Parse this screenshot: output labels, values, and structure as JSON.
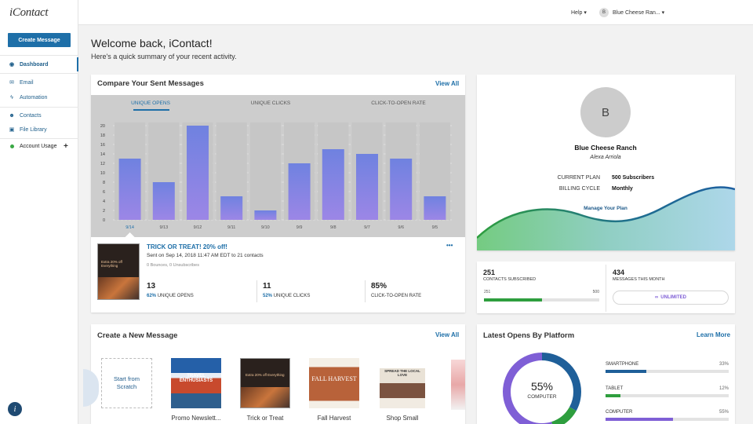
{
  "app": {
    "logo": "iContact",
    "logo_mark": "i"
  },
  "sidebar": {
    "create_button": "Create Message",
    "items": [
      {
        "label": "Dashboard",
        "icon": "dashboard-icon"
      },
      {
        "label": "Email",
        "icon": "envelope-icon"
      },
      {
        "label": "Automation",
        "icon": "bolt-icon"
      },
      {
        "label": "Contacts",
        "icon": "people-icon"
      },
      {
        "label": "File Library",
        "icon": "image-icon"
      },
      {
        "label": "Account Usage",
        "icon": "status-dot-icon"
      }
    ],
    "usage_expand": "+"
  },
  "topbar": {
    "help_label": "Help ▾",
    "account_initial": "B",
    "account_name": "Blue Cheese Ran... ▾"
  },
  "welcome": {
    "title": "Welcome back, iContact!",
    "subtitle": "Here's a quick summary of your recent activity."
  },
  "compare": {
    "title": "Compare Your Sent Messages",
    "view_all": "View All",
    "tabs": [
      "UNIQUE OPENS",
      "UNIQUE CLICKS",
      "CLICK-TO-OPEN RATE"
    ],
    "active_tab": 0,
    "chart_data": {
      "type": "bar",
      "categories": [
        "9/14",
        "9/13",
        "9/12",
        "9/11",
        "9/10",
        "9/9",
        "9/8",
        "9/7",
        "9/6",
        "9/5"
      ],
      "values": [
        13,
        8,
        20,
        5,
        2,
        12,
        15,
        14,
        13,
        5
      ],
      "ylim": [
        0,
        20
      ],
      "yticks": [
        "20",
        "18",
        "16",
        "14",
        "12",
        "10",
        "8",
        "6",
        "4",
        "2",
        "0"
      ],
      "grid": true,
      "selected_category": "9/14"
    },
    "message": {
      "title": "TRICK OR TREAT! 20% off!",
      "sent": "Sent on Sep 14, 2018 11:47 AM EDT to 21 contacts",
      "bounces": "0 Bounces, 0 Unsubscribes",
      "more": "•••",
      "thumb_text": "Extra 20% off Everything",
      "stats": [
        {
          "value": "13",
          "pct": "62%",
          "label": "UNIQUE OPENS"
        },
        {
          "value": "11",
          "pct": "52%",
          "label": "UNIQUE CLICKS"
        },
        {
          "value": "85%",
          "pct": "",
          "label": "CLICK-TO-OPEN RATE"
        }
      ]
    }
  },
  "profile": {
    "initial": "B",
    "company": "Blue Cheese Ranch",
    "user": "Alexa Arriola",
    "plan_label": "CURRENT PLAN",
    "plan_value": "500 Subscribers",
    "billing_label": "BILLING CYCLE",
    "billing_value": "Monthly",
    "manage_link": "Manage Your Plan"
  },
  "stats": {
    "subscribed_value": "251",
    "subscribed_label": "CONTACTS SUBSCRIBED",
    "subscribed_current": "251",
    "subscribed_max": "500",
    "subscribed_fraction": 0.502,
    "messages_value": "434",
    "messages_label": "MESSAGES THIS MONTH",
    "messages_badge": "UNLIMITED"
  },
  "create": {
    "title": "Create a New Message",
    "view_all": "View All",
    "scratch_label": "Start from Scratch",
    "templates": [
      {
        "name": "Promo Newslett...",
        "thumb_text": "TRAVEL ENTHUSIASTS"
      },
      {
        "name": "Trick or Treat",
        "thumb_text": "Extra 20% off Everything"
      },
      {
        "name": "Fall Harvest",
        "thumb_text": "FALL HARVEST"
      },
      {
        "name": "Shop Small",
        "thumb_text": "SPREAD THE LOCAL LOVE"
      }
    ]
  },
  "platform": {
    "title": "Latest Opens By Platform",
    "learn_more": "Learn More",
    "center_pct": "55%",
    "center_label": "COMPUTER",
    "rows": [
      {
        "label": "SMARTPHONE",
        "pct": "33%",
        "value": 33,
        "color": "#1f5f99"
      },
      {
        "label": "TABLET",
        "pct": "12%",
        "value": 12,
        "color": "#2e9e3e"
      },
      {
        "label": "COMPUTER",
        "pct": "55%",
        "value": 55,
        "color": "#7f5fd6"
      }
    ]
  },
  "colors": {
    "primary": "#1e6fa8",
    "green": "#2e9e3e",
    "purple": "#7f5fd6",
    "bar_top": "#6f7ee0",
    "bar_bottom": "#9f8ae6"
  }
}
